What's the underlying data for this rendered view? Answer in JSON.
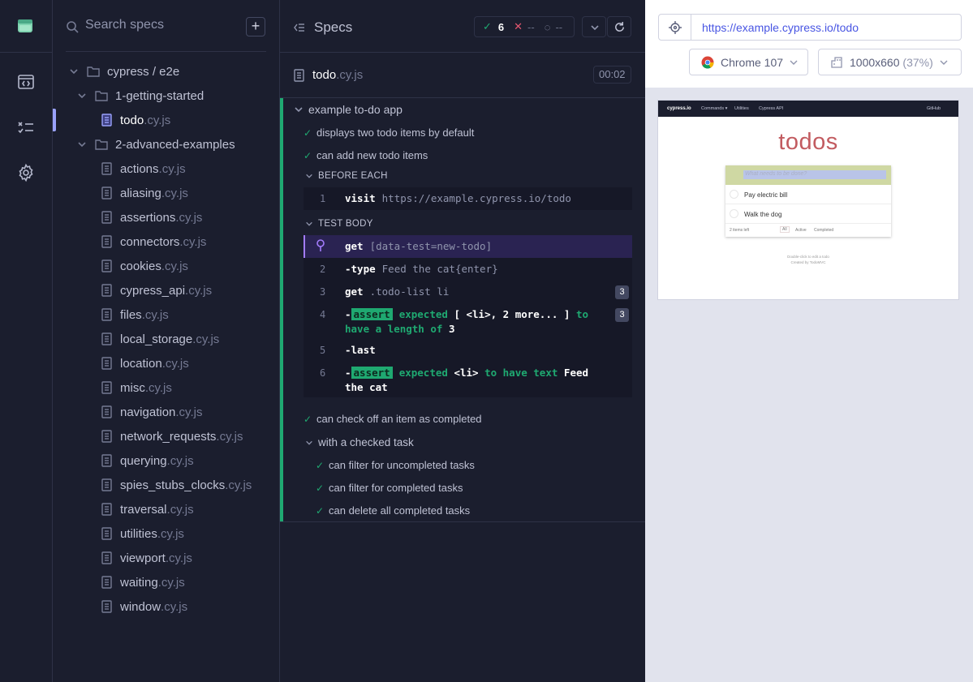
{
  "rail": {
    "icons": [
      "cypress-logo-icon",
      "specs-browser-icon",
      "runs-icon",
      "settings-gear-icon"
    ]
  },
  "specs": {
    "search_placeholder": "Search specs",
    "add_label": "+",
    "root": "cypress / e2e",
    "folder1": "1-getting-started",
    "folder2": "2-advanced-examples",
    "active_file": {
      "name": "todo",
      "ext": ".cy.js"
    },
    "files": [
      {
        "name": "actions",
        "ext": ".cy.js"
      },
      {
        "name": "aliasing",
        "ext": ".cy.js"
      },
      {
        "name": "assertions",
        "ext": ".cy.js"
      },
      {
        "name": "connectors",
        "ext": ".cy.js"
      },
      {
        "name": "cookies",
        "ext": ".cy.js"
      },
      {
        "name": "cypress_api",
        "ext": ".cy.js"
      },
      {
        "name": "files",
        "ext": ".cy.js"
      },
      {
        "name": "local_storage",
        "ext": ".cy.js"
      },
      {
        "name": "location",
        "ext": ".cy.js"
      },
      {
        "name": "misc",
        "ext": ".cy.js"
      },
      {
        "name": "navigation",
        "ext": ".cy.js"
      },
      {
        "name": "network_requests",
        "ext": ".cy.js"
      },
      {
        "name": "querying",
        "ext": ".cy.js"
      },
      {
        "name": "spies_stubs_clocks",
        "ext": ".cy.js"
      },
      {
        "name": "traversal",
        "ext": ".cy.js"
      },
      {
        "name": "utilities",
        "ext": ".cy.js"
      },
      {
        "name": "viewport",
        "ext": ".cy.js"
      },
      {
        "name": "waiting",
        "ext": ".cy.js"
      },
      {
        "name": "window",
        "ext": ".cy.js"
      }
    ]
  },
  "reporter": {
    "title": "Specs",
    "passed": "6",
    "failed": "--",
    "pending": "--",
    "spec_name": "todo",
    "spec_ext": ".cy.js",
    "duration": "00:02",
    "suite": "example to-do app",
    "test1": "displays two todo items by default",
    "test2": "can add new todo items",
    "before_each": "BEFORE EACH",
    "test_body": "TEST BODY",
    "be_cmd": {
      "num": "1",
      "name": "visit",
      "arg": "https://example.cypress.io/todo"
    },
    "commands": [
      {
        "num": "",
        "name": "get",
        "arg": "[data-test=new-todo]"
      },
      {
        "num": "2",
        "name": "-type",
        "arg": "Feed the cat{enter}"
      },
      {
        "num": "3",
        "name": "get",
        "arg": ".todo-list li",
        "count": "3"
      },
      {
        "num": "4",
        "prefix": "-",
        "badge": "assert",
        "m1": "expected",
        "m2": "[ <li>, 2 more... ]",
        "m3": "to have a length of",
        "m4": "3",
        "count": "3"
      },
      {
        "num": "5",
        "name": "-last",
        "arg": ""
      },
      {
        "num": "6",
        "prefix": "-",
        "badge": "assert",
        "m1": "expected",
        "m2": "<li>",
        "m3": "to have text",
        "m4": "Feed the cat"
      }
    ],
    "test3": "can check off an item as completed",
    "sub_suite": "with a checked task",
    "test4": "can filter for uncompleted tasks",
    "test5": "can filter for completed tasks",
    "test6": "can delete all completed tasks"
  },
  "aut": {
    "url": "https://example.cypress.io/todo",
    "browser": "Chrome 107",
    "viewport": "1000x660",
    "zoom": "(37%)",
    "app": {
      "brand": "cypress.io",
      "nav": [
        "Commands ▾",
        "Utilities",
        "Cypress API"
      ],
      "github": "GitHub",
      "title": "todos",
      "placeholder": "What needs to be done?",
      "items": [
        "Pay electric bill",
        "Walk the dog"
      ],
      "footer": {
        "left": "2 items left",
        "all": "All",
        "active": "Active",
        "completed": "Completed"
      },
      "info1": "Double-click to edit a todo",
      "info2": "Created by TodoMVC"
    }
  },
  "colors": {
    "pass": "#1fa971",
    "fail": "#e45770",
    "accent": "#9aa2fc",
    "pin": "#a37cfc",
    "url": "#4956e3"
  }
}
